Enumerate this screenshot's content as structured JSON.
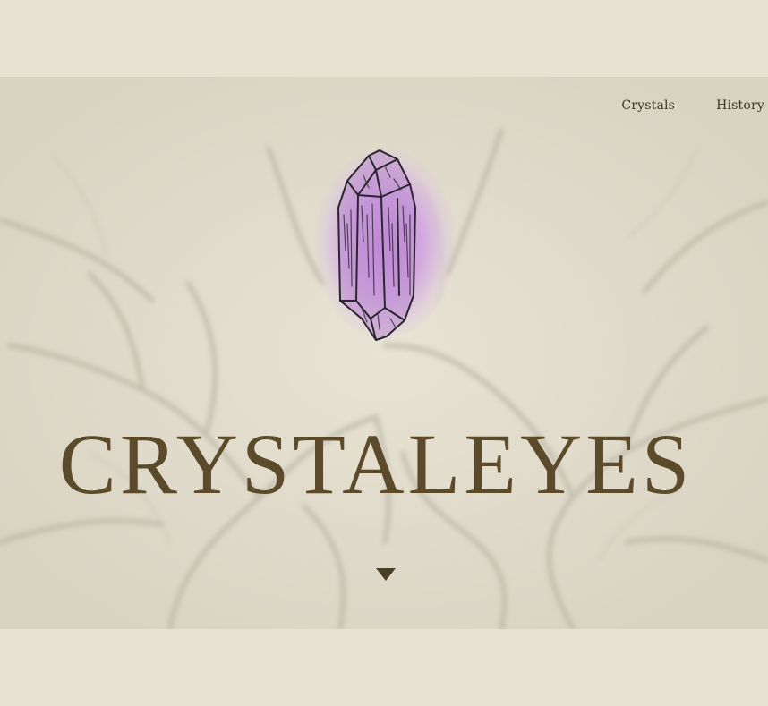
{
  "nav": {
    "items": [
      {
        "label": "Crystals"
      },
      {
        "label": "History"
      }
    ]
  },
  "hero": {
    "title": "CRYSTALEYES",
    "crystal_icon": "amethyst-crystal-illustration",
    "scroll_icon": "triangle-down-icon"
  },
  "colors": {
    "background": "#e6e1d2",
    "hero_background": "#e3ddcc",
    "title": "#5b4b2a",
    "nav_text": "#3b3420",
    "crystal_glow": "#c482e1",
    "crystal_fill": "#b98ad0"
  }
}
